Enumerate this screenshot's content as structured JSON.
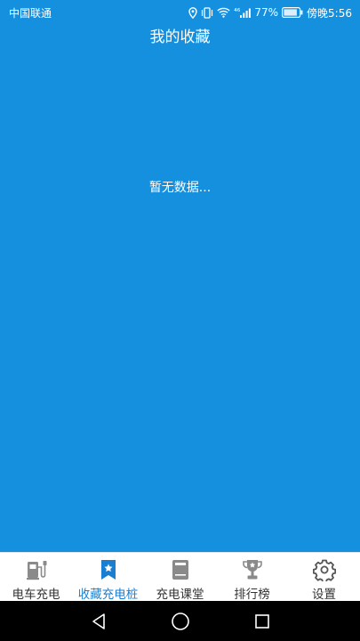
{
  "status_bar": {
    "carrier": "中国联通",
    "network_badge": "⁴⁶",
    "battery": "77%",
    "time": "傍晚5:56",
    "icons": [
      "location-icon",
      "vibrate-icon",
      "wifi-icon",
      "signal-icon",
      "battery-icon"
    ]
  },
  "header": {
    "title": "我的收藏"
  },
  "main": {
    "empty_message": "暂无数据..."
  },
  "tabs": [
    {
      "label": "电车充电",
      "icon": "charging-station-icon",
      "active": false
    },
    {
      "label": "收藏充电桩",
      "icon": "bookmark-star-icon",
      "active": true
    },
    {
      "label": "充电课堂",
      "icon": "book-icon",
      "active": false
    },
    {
      "label": "排行榜",
      "icon": "trophy-icon",
      "active": false
    },
    {
      "label": "设置",
      "icon": "gear-icon",
      "active": false
    }
  ],
  "colors": {
    "background": "#1490df",
    "tab_active": "#1a7fd0",
    "tab_inactive_icon": "#8a8a8a",
    "tab_label": "#333333"
  },
  "nav_bar": {
    "buttons": [
      "back-icon",
      "home-icon",
      "recents-icon"
    ]
  }
}
